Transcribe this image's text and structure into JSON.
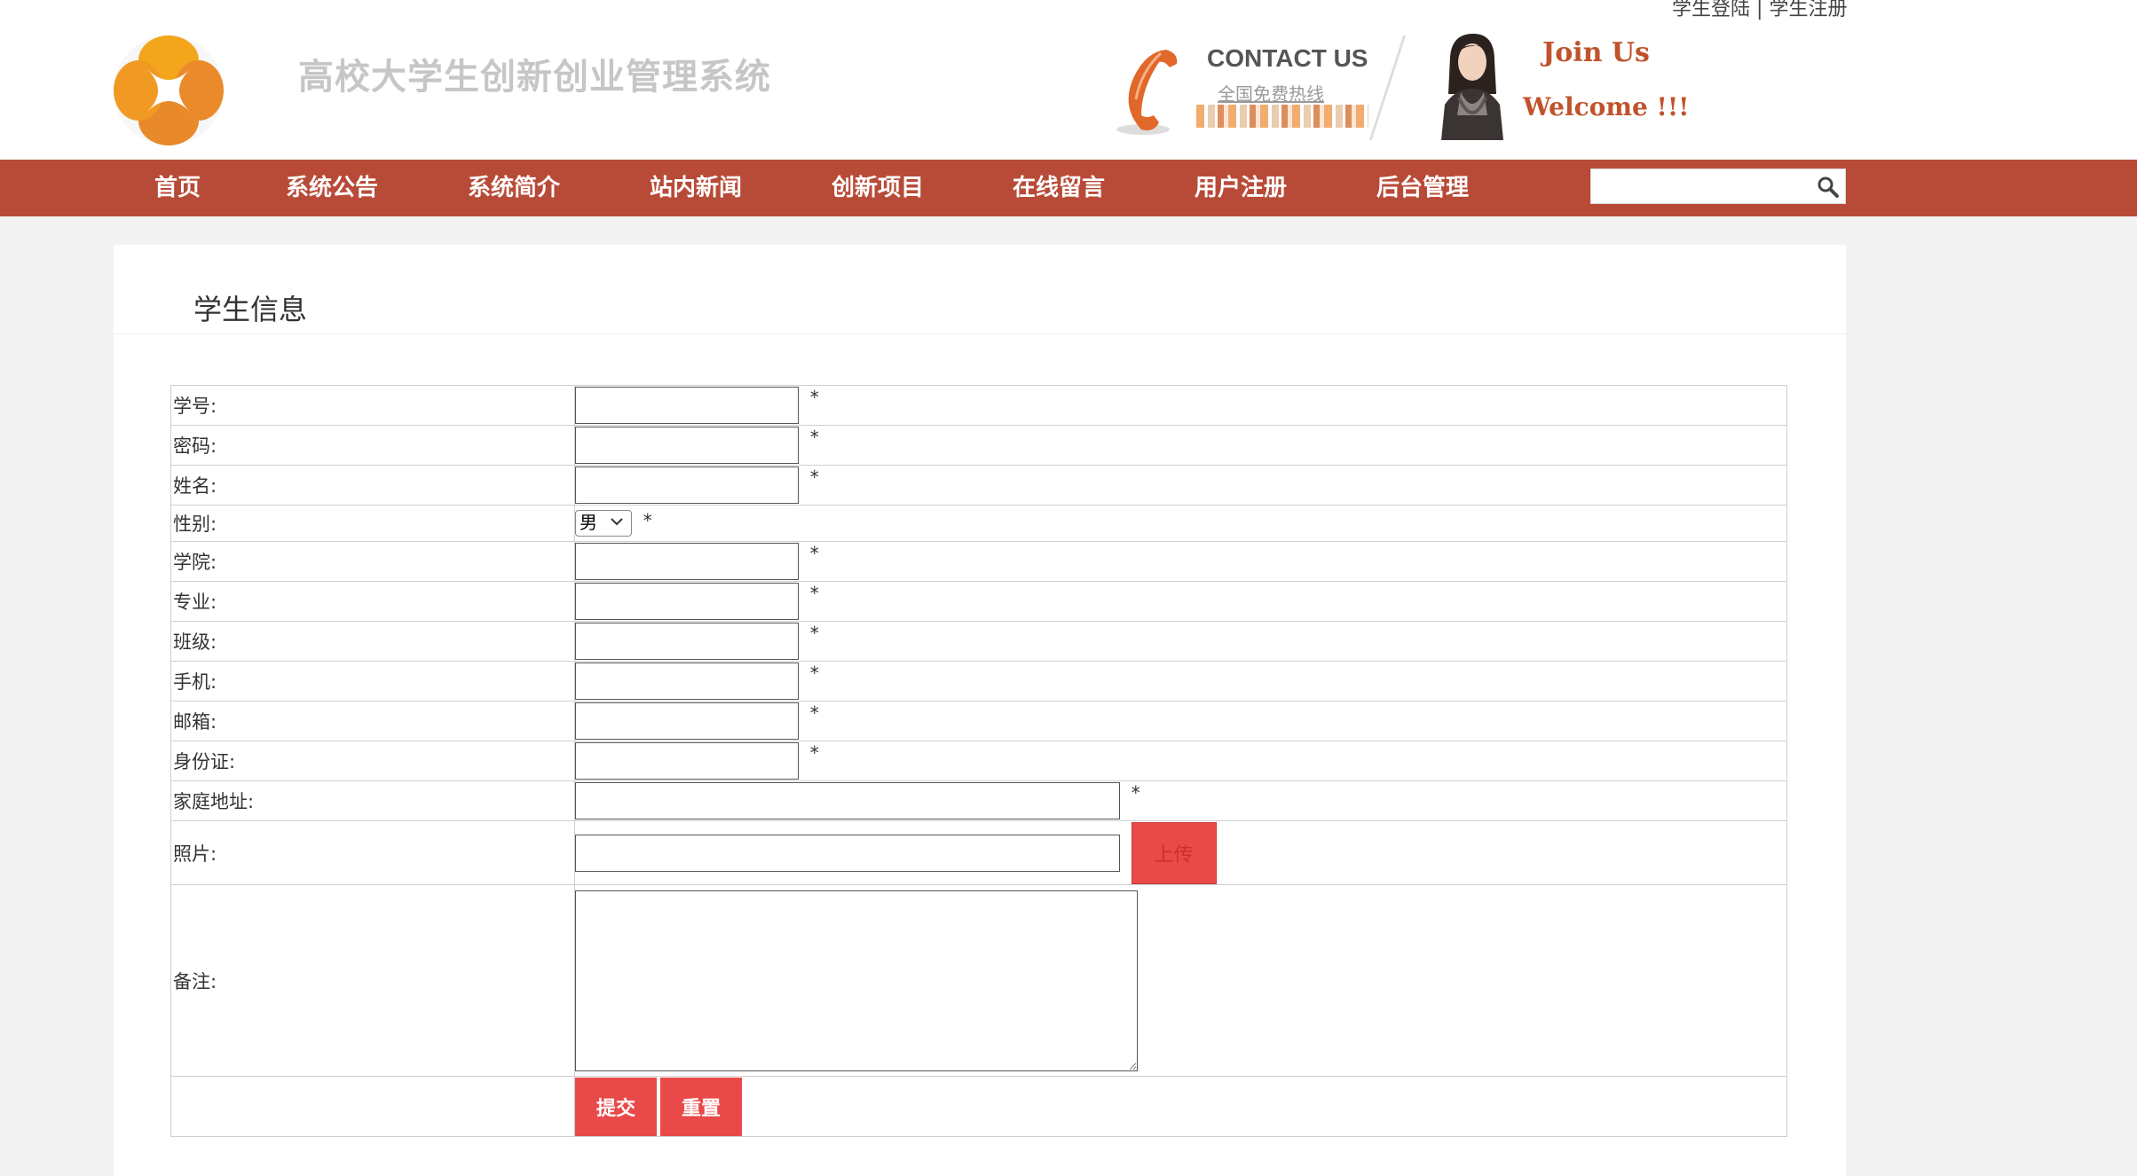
{
  "header": {
    "site_title": "高校大学生创新创业管理系统",
    "top_links": {
      "login": "学生登陆",
      "separator": "|",
      "register": "学生注册"
    },
    "contact": {
      "title": "CONTACT US",
      "hotline_label": "全国免费热线"
    },
    "join_us": "Join Us",
    "welcome": "Welcome !!!"
  },
  "nav": {
    "items": [
      {
        "label": "首页"
      },
      {
        "label": "系统公告"
      },
      {
        "label": "系统简介"
      },
      {
        "label": "站内新闻"
      },
      {
        "label": "创新项目"
      },
      {
        "label": "在线留言"
      },
      {
        "label": "用户注册"
      },
      {
        "label": "后台管理"
      }
    ],
    "search": {
      "value": "",
      "placeholder": ""
    }
  },
  "panel": {
    "title": "学生信息"
  },
  "form": {
    "fields": {
      "student_id": {
        "label": "学号:",
        "value": ""
      },
      "password": {
        "label": "密码:",
        "value": ""
      },
      "name": {
        "label": "姓名:",
        "value": ""
      },
      "gender": {
        "label": "性别:",
        "selected": "男"
      },
      "college": {
        "label": "学院:",
        "value": ""
      },
      "major": {
        "label": "专业:",
        "value": ""
      },
      "class": {
        "label": "班级:",
        "value": ""
      },
      "phone": {
        "label": "手机:",
        "value": ""
      },
      "email": {
        "label": "邮箱:",
        "value": ""
      },
      "id_card": {
        "label": "身份证:",
        "value": ""
      },
      "address": {
        "label": "家庭地址:",
        "value": ""
      },
      "photo": {
        "label": "照片:",
        "value": "",
        "upload_label": "上传"
      },
      "notes": {
        "label": "备注:",
        "value": ""
      }
    },
    "required_mark": "*",
    "submit_label": "提交",
    "reset_label": "重置"
  },
  "colors": {
    "nav_bg": "#b84b38",
    "button_bg": "#e94a49",
    "accent": "#c0532c"
  }
}
